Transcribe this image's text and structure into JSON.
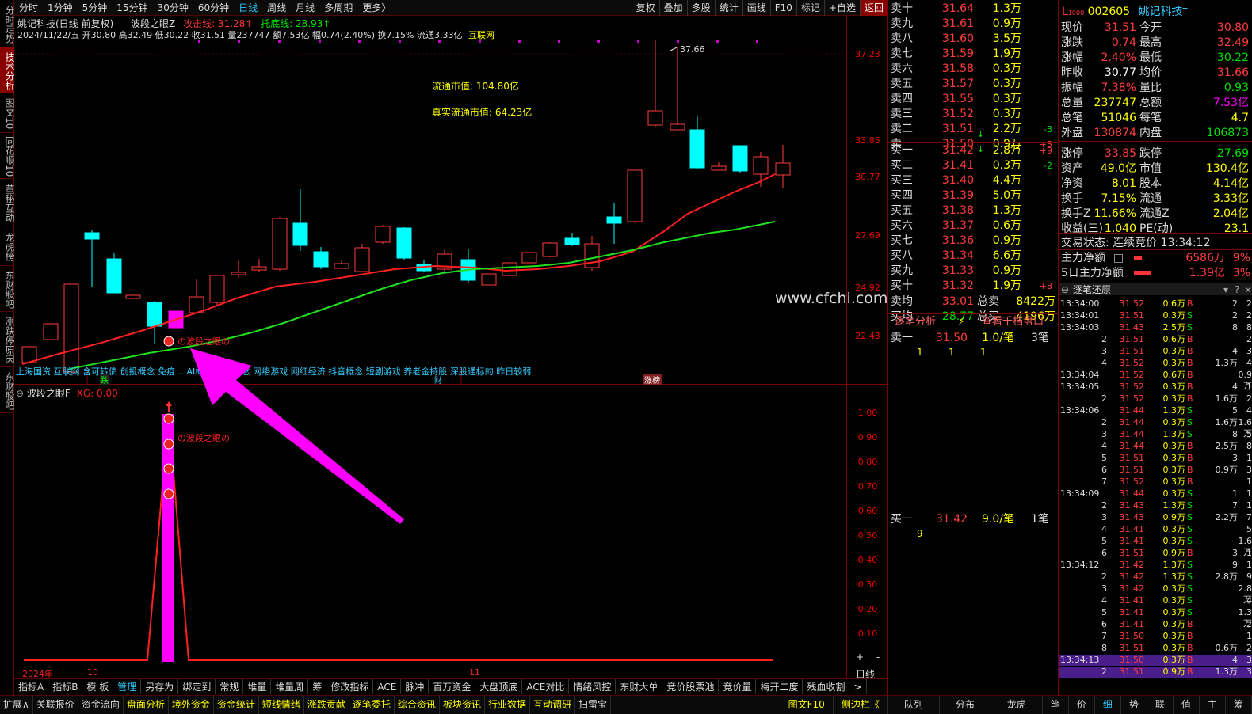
{
  "left_tabs": [
    "分时走势",
    "技术分析",
    "图文10",
    "同花顺10",
    "董秘互动",
    "龙虎榜",
    "东财股吧",
    "涨跌停原因",
    "东财股吧"
  ],
  "topbar": {
    "items": [
      "分时",
      "1分钟",
      "5分钟",
      "15分钟",
      "30分钟",
      "60分钟",
      "日线",
      "周线",
      "月线",
      "多周期",
      "更多〉"
    ],
    "right": [
      "复权",
      "叠加",
      "多股",
      "统计",
      "画线",
      "F10",
      "标记",
      "+自选",
      "返回"
    ]
  },
  "chart": {
    "title": "姚记科技(日线 前复权)",
    "indicator": "波段之眼Z",
    "attack_label": "攻击线: 31.28↑",
    "support_label": "托底线: 28.93↑",
    "ohlc": "2024/11/22/五 开30.80 高32.49 低30.22 收31.51 量237747 额7.53亿 幅0.74(2.40%) 换7.15% 流通3.33亿",
    "sector": "互联网",
    "mcap1": "流通市值: 104.80亿",
    "mcap2": "真实流通市值: 64.23亿",
    "peak_label": "37.66",
    "axis": [
      "37.23",
      "33.85",
      "30.77",
      "27.69",
      "24.92",
      "22.43"
    ],
    "marker_label": "の波段之眼の",
    "concepts": "上海国资 互联网 含可转债 创投概念 免疫 …AI概念 博彩概念 网络游戏 网红经济 抖音概念 短剧游戏 养老金持股 深股通标的 昨日较弱",
    "flags": [
      "跌",
      "财",
      "涨榜"
    ],
    "watermark": "www.cfchi.com",
    "x_labels": [
      "2024年",
      "10",
      "11"
    ]
  },
  "subchart": {
    "title": "波段之眼F",
    "xg": "XG: 0.00",
    "axis": [
      "1.00",
      "0.90",
      "0.80",
      "0.70",
      "0.60",
      "0.50",
      "0.40",
      "0.30",
      "0.20",
      "0.10"
    ],
    "marker_label": "の波段之眼の",
    "period": "日线"
  },
  "bottom_tabs": [
    "指标A",
    "指标B",
    "模 板",
    "管理",
    "另存为",
    "绑定到",
    "常规",
    "堆量",
    "堆量周",
    "筹",
    "修改指标",
    "ACE",
    "脉冲",
    "百万资金",
    "大盘顶底",
    "ACE对比",
    "情绪风控",
    "东财大单",
    "竞价股票池",
    "竞价量",
    "梅开二度",
    "残血收割",
    ">"
  ],
  "bottom_bar": [
    "扩展∧",
    "关联报价",
    "资金流向",
    "盘面分析",
    "境外资金",
    "资金统计",
    "短线情绪",
    "涨跌贡献",
    "逐笔委托",
    "综合资讯",
    "板块资讯",
    "行业数据",
    "互动调研",
    "扫雷宝"
  ],
  "bottom_right": [
    "图文F10",
    "侧边栏《",
    "队列",
    "分布",
    "龙虎",
    "笔",
    "价",
    "细",
    "势",
    "联",
    "值",
    "主",
    "筹"
  ],
  "book": {
    "asks": [
      {
        "label": "卖十",
        "price": "31.64",
        "vol": "1.3万",
        "d": ""
      },
      {
        "label": "卖九",
        "price": "31.61",
        "vol": "0.9万",
        "d": ""
      },
      {
        "label": "卖八",
        "price": "31.60",
        "vol": "3.5万",
        "d": ""
      },
      {
        "label": "卖七",
        "price": "31.59",
        "vol": "1.9万",
        "d": ""
      },
      {
        "label": "卖六",
        "price": "31.58",
        "vol": "0.3万",
        "d": ""
      },
      {
        "label": "卖五",
        "price": "31.57",
        "vol": "0.3万",
        "d": ""
      },
      {
        "label": "卖四",
        "price": "31.55",
        "vol": "0.3万",
        "d": ""
      },
      {
        "label": "卖三",
        "price": "31.52",
        "vol": "0.3万",
        "d": ""
      },
      {
        "label": "卖二",
        "price": "31.51",
        "vol": "2.2万",
        "d": "-3"
      },
      {
        "label": "卖一",
        "price": "31.50",
        "vol": "0.9万",
        "d": "+3"
      }
    ],
    "bids": [
      {
        "label": "买一",
        "price": "31.42",
        "vol": "2.8万",
        "d": "+9"
      },
      {
        "label": "买二",
        "price": "31.41",
        "vol": "0.3万",
        "d": "-2"
      },
      {
        "label": "买三",
        "price": "31.40",
        "vol": "4.4万",
        "d": ""
      },
      {
        "label": "买四",
        "price": "31.39",
        "vol": "5.0万",
        "d": ""
      },
      {
        "label": "买五",
        "price": "31.38",
        "vol": "1.3万",
        "d": ""
      },
      {
        "label": "买六",
        "price": "31.37",
        "vol": "0.6万",
        "d": ""
      },
      {
        "label": "买七",
        "price": "31.36",
        "vol": "0.9万",
        "d": ""
      },
      {
        "label": "买八",
        "price": "31.34",
        "vol": "6.6万",
        "d": ""
      },
      {
        "label": "买九",
        "price": "31.33",
        "vol": "0.9万",
        "d": ""
      },
      {
        "label": "买十",
        "price": "31.32",
        "vol": "1.9万",
        "d": "+8"
      }
    ],
    "avg_sell": {
      "label": "卖均",
      "price": "33.01",
      "tlabel": "总卖",
      "tval": "8422万"
    },
    "avg_buy": {
      "label": "买均",
      "price": "28.77",
      "tlabel": "总买",
      "tval": "4196万"
    },
    "tabs": [
      "逐笔分析",
      "查看千档盘口"
    ],
    "sell1": {
      "label": "卖一",
      "price": "31.50",
      "v": "1.0/笔",
      "n": "3笔",
      "details": [
        "1",
        "1",
        "1"
      ]
    },
    "buy1": {
      "label": "买一",
      "price": "31.42",
      "v": "9.0/笔",
      "n": "1笔",
      "details": [
        "9"
      ]
    }
  },
  "quote": {
    "code": "002605",
    "name": "姚记科技",
    "rows": [
      [
        "现价",
        "31.51",
        "今开",
        "30.80"
      ],
      [
        "涨跌",
        "0.74",
        "最高",
        "32.49"
      ],
      [
        "涨幅",
        "2.40%",
        "最低",
        "30.22"
      ],
      [
        "昨收",
        "30.77",
        "均价",
        "31.66"
      ],
      [
        "振幅",
        "7.38%",
        "量比",
        "0.93"
      ],
      [
        "总量",
        "237747",
        "总额",
        "7.53亿"
      ],
      [
        "总笔",
        "51046",
        "每笔",
        "4.7"
      ],
      [
        "外盘",
        "130874",
        "内盘",
        "106873"
      ],
      [
        "涨停",
        "33.85",
        "跌停",
        "27.69"
      ],
      [
        "资产",
        "49.0亿",
        "市值",
        "130.4亿"
      ],
      [
        "净资",
        "8.01",
        "股本",
        "4.14亿"
      ],
      [
        "换手",
        "7.15%",
        "流通",
        "3.33亿"
      ],
      [
        "换手Z",
        "11.66%",
        "流通Z",
        "2.04亿"
      ],
      [
        "收益(三)",
        "1.040",
        "PE(动)",
        "23.1"
      ]
    ],
    "status": "交易状态: 连续竞价 13:34:12",
    "main_flow": {
      "label": "主力净额",
      "value": "6586万",
      "pct": "9%"
    },
    "flow5": {
      "label": "5日主力净额",
      "value": "1.39亿",
      "pct": "3%"
    },
    "tick_title": "逐笔还原",
    "ticks": [
      [
        "13:34:00",
        "31.52",
        "0.6万",
        "B",
        "2",
        "2"
      ],
      [
        "13:34:01",
        "31.51",
        "0.3万",
        "S",
        "2",
        "2"
      ],
      [
        "13:34:03",
        "31.43",
        "2.5万",
        "S",
        "8",
        "8"
      ],
      [
        "2",
        "31.51",
        "0.6万",
        "B",
        "",
        "2"
      ],
      [
        "3",
        "31.51",
        "0.3万",
        "B",
        "4",
        "3"
      ],
      [
        "4",
        "31.52",
        "0.3万",
        "B",
        "1.3万",
        "4"
      ],
      [
        "13:34:04",
        "31.52",
        "0.6万",
        "B",
        "",
        "0.9万"
      ],
      [
        "13:34:05",
        "31.52",
        "0.3万",
        "B",
        "4",
        "1"
      ],
      [
        "2",
        "31.52",
        "0.3万",
        "B",
        "1.6万",
        "2"
      ],
      [
        "13:34:06",
        "31.44",
        "1.3万",
        "S",
        "5",
        "4"
      ],
      [
        "2",
        "31.44",
        "0.3万",
        "S",
        "1.6万",
        "1.6万"
      ],
      [
        "3",
        "31.44",
        "1.3万",
        "S",
        "8",
        "5"
      ],
      [
        "4",
        "31.44",
        "0.3万",
        "B",
        "2.5万",
        "8"
      ],
      [
        "5",
        "31.51",
        "0.3万",
        "B",
        "3",
        "1"
      ],
      [
        "6",
        "31.51",
        "0.3万",
        "B",
        "0.9万",
        "3"
      ],
      [
        "7",
        "31.52",
        "0.3万",
        "B",
        "",
        "1"
      ],
      [
        "13:34:09",
        "31.44",
        "0.3万",
        "S",
        "1",
        "1"
      ],
      [
        "2",
        "31.43",
        "1.3万",
        "S",
        "7",
        "1"
      ],
      [
        "3",
        "31.43",
        "0.9万",
        "S",
        "2.2万",
        "7"
      ],
      [
        "4",
        "31.41",
        "0.3万",
        "S",
        "",
        "5"
      ],
      [
        "5",
        "31.41",
        "0.3万",
        "S",
        "",
        "1.6万"
      ],
      [
        "6",
        "31.51",
        "0.9万",
        "B",
        "3",
        "1"
      ],
      [
        "13:34:12",
        "31.42",
        "1.3万",
        "S",
        "9",
        "1"
      ],
      [
        "2",
        "31.42",
        "1.3万",
        "S",
        "2.8万",
        "9"
      ],
      [
        "3",
        "31.42",
        "0.3万",
        "S",
        "",
        "2.8万"
      ],
      [
        "4",
        "31.41",
        "0.3万",
        "S",
        "",
        "4"
      ],
      [
        "5",
        "31.41",
        "0.3万",
        "S",
        "",
        "1.3万"
      ],
      [
        "6",
        "31.41",
        "0.3万",
        "B",
        "",
        "2"
      ],
      [
        "7",
        "31.50",
        "0.3万",
        "B",
        "",
        "1"
      ],
      [
        "8",
        "31.51",
        "0.3万",
        "B",
        "0.6万",
        "2"
      ],
      [
        "13:34:13",
        "31.50",
        "0.3万",
        "B",
        "4",
        "3"
      ],
      [
        "2",
        "31.51",
        "0.9万",
        "B",
        "1.3万",
        "3"
      ]
    ]
  }
}
